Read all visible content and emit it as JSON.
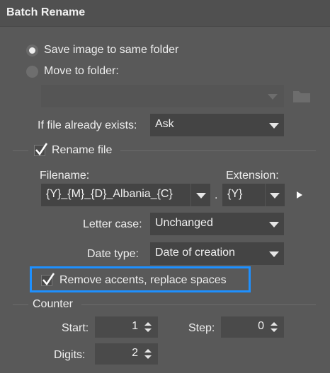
{
  "window": {
    "title": "Batch Rename"
  },
  "save_options": {
    "same_folder_label": "Save image to same folder",
    "move_folder_label": "Move to folder:",
    "folder_path_value": "",
    "if_exists_label": "If file already exists:",
    "if_exists_value": "Ask"
  },
  "rename": {
    "rename_label": "Rename file",
    "filename_label": "Filename:",
    "filename_value": "{Y}_{M}_{D}_Albania_{C}",
    "dot": ".",
    "extension_label": "Extension:",
    "extension_value": "{Y}",
    "letter_case_label": "Letter case:",
    "letter_case_value": "Unchanged",
    "date_type_label": "Date type:",
    "date_type_value": "Date of creation",
    "remove_accents_label": "Remove accents, replace spaces"
  },
  "counter": {
    "title": "Counter",
    "start_label": "Start:",
    "start_value": "1",
    "step_label": "Step:",
    "step_value": "0",
    "digits_label": "Digits:",
    "digits_value": "2"
  },
  "state": {
    "same_folder_selected": true,
    "rename_checked": true,
    "remove_accents_checked": true
  },
  "colors": {
    "background": "#595959",
    "field": "#444444",
    "highlight": "#1e90ff"
  },
  "icons": {
    "folder": "folder-icon",
    "more": "play-arrow-icon",
    "dropdown": "chevron-down-icon"
  }
}
